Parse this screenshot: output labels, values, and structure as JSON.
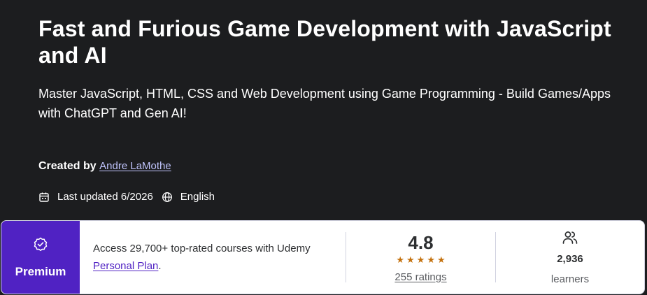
{
  "course": {
    "title": "Fast and Furious Game Development with JavaScript and AI",
    "subtitle": "Master JavaScript, HTML, CSS and Web Development using Game Programming - Build Games/Apps with ChatGPT and Gen AI!",
    "created_by_label": "Created by",
    "instructor": "Andre LaMothe",
    "last_updated": "Last updated 6/2026",
    "language": "English"
  },
  "icons": {
    "calendar": "calendar-icon",
    "language": "globe-icon",
    "premium": "premium-badge-icon",
    "learners": "people-icon"
  },
  "premium": {
    "label": "Premium",
    "access_text": "Access 29,700+ top-rated courses with Udemy ",
    "plan_link": "Personal Plan",
    "plan_suffix": "."
  },
  "rating": {
    "score": "4.8",
    "stars": 4.8,
    "ratings_text": "255 ratings"
  },
  "learners": {
    "count": "2,936",
    "label": "learners"
  },
  "colors": {
    "background": "#1c1d1f",
    "premium": "#5022c3",
    "star": "#c4710d",
    "instructor_link": "#c0c4fc"
  }
}
